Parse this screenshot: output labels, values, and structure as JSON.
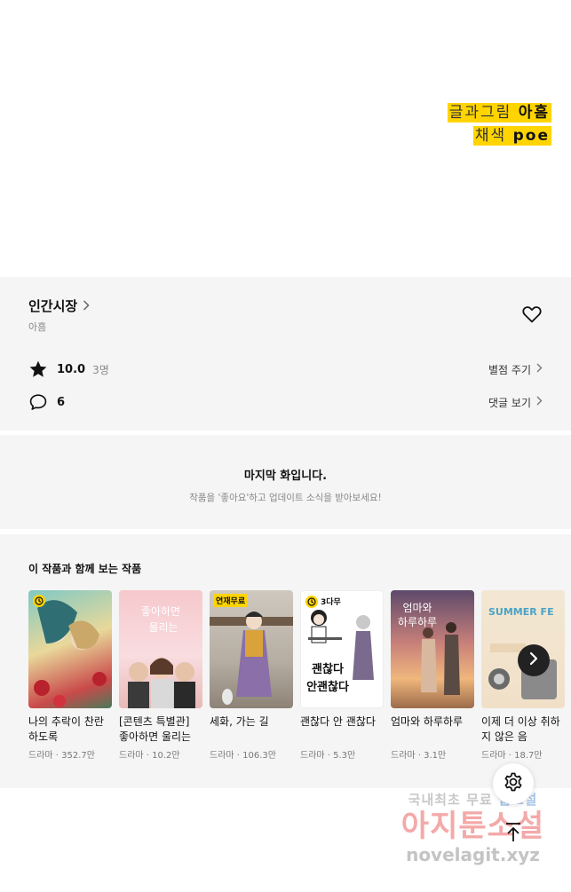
{
  "credits": [
    {
      "role": "글과그림",
      "name": "아흠"
    },
    {
      "role": "채색",
      "name": "poe"
    }
  ],
  "work": {
    "title": "인간시장",
    "author": "아흠",
    "rating": "10.0",
    "rating_count": "3명",
    "rate_link": "별점 주기",
    "comment_count": "6",
    "comment_link": "댓글 보기"
  },
  "last_episode": {
    "title": "마지막 화입니다.",
    "subtitle": "작품을 '좋아요'하고 업데이트 소식을 받아보세요!"
  },
  "recommendations": {
    "heading": "이 작품과 함께 보는 작품",
    "items": [
      {
        "title": "나의 추락이 찬란하도록",
        "meta": "드라마 · 352.7만",
        "badge": "clock"
      },
      {
        "title": "[콘텐츠 특별관] 좋아하면 울리는",
        "meta": "드라마 · 10.2만",
        "badge": ""
      },
      {
        "title": "세화, 가는 길",
        "meta": "드라마 · 106.3만",
        "badge": "연재무료"
      },
      {
        "title": "괜찮다 안 괜찮다",
        "meta": "드라마 · 5.3만",
        "badge": "3다무"
      },
      {
        "title": "엄마와 하루하루",
        "meta": "드라마 · 3.1만",
        "badge": ""
      },
      {
        "title": "이제 더 이상 취하지 않은 음",
        "meta": "드라마 · 18.7만",
        "badge": ""
      }
    ]
  },
  "watermark": {
    "line1a": "국내최초 무료",
    "line1b": "웹소설",
    "line2": "아지툰소설",
    "line3": "novelagit.xyz"
  },
  "colors": {
    "highlight": "#ffd400",
    "panel_bg": "#f5f5f5"
  },
  "icons": [
    "chevron-right-icon",
    "heart-icon",
    "star-icon",
    "comment-icon",
    "settings-icon",
    "scroll-top-icon",
    "next-arrow-icon"
  ]
}
